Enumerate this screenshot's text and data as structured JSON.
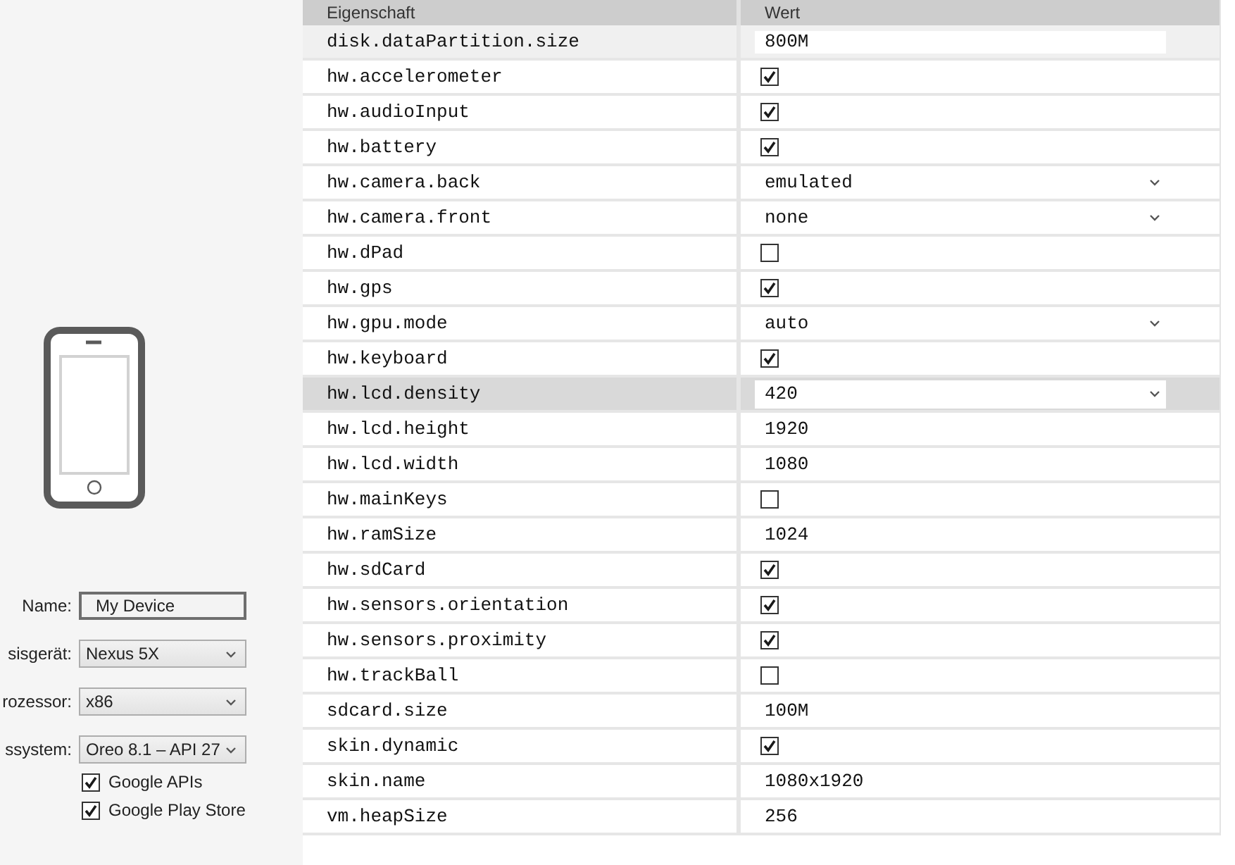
{
  "device_panel": {
    "fields": [
      {
        "kind": "text",
        "label": "Name:",
        "value": "My Device"
      },
      {
        "kind": "dropdown",
        "label": "sisgerät:",
        "value": "Nexus 5X"
      },
      {
        "kind": "dropdown",
        "label": "rozessor:",
        "value": "x86"
      },
      {
        "kind": "dropdown",
        "label": "ssystem:",
        "value": "Oreo 8.1 – API 27"
      }
    ],
    "options": [
      {
        "label": "Google APIs",
        "checked": true
      },
      {
        "label": "Google Play Store",
        "checked": true
      }
    ]
  },
  "table": {
    "columns": [
      {
        "label": "Eigenschaft"
      },
      {
        "label": "Wert"
      }
    ],
    "rows": [
      {
        "name": "disk.dataPartition.size",
        "kind": "text",
        "value": "800M",
        "selected": false,
        "hovered": true
      },
      {
        "name": "hw.accelerometer",
        "kind": "checkbox",
        "checked": true,
        "selected": false,
        "hovered": false
      },
      {
        "name": "hw.audioInput",
        "kind": "checkbox",
        "checked": true,
        "selected": false,
        "hovered": false
      },
      {
        "name": "hw.battery",
        "kind": "checkbox",
        "checked": true,
        "selected": false,
        "hovered": false
      },
      {
        "name": "hw.camera.back",
        "kind": "dropdown",
        "value": "emulated",
        "selected": false,
        "hovered": false
      },
      {
        "name": "hw.camera.front",
        "kind": "dropdown",
        "value": "none",
        "selected": false,
        "hovered": false
      },
      {
        "name": "hw.dPad",
        "kind": "checkbox",
        "checked": false,
        "selected": false,
        "hovered": false
      },
      {
        "name": "hw.gps",
        "kind": "checkbox",
        "checked": true,
        "selected": false,
        "hovered": false
      },
      {
        "name": "hw.gpu.mode",
        "kind": "dropdown",
        "value": "auto",
        "selected": false,
        "hovered": false
      },
      {
        "name": "hw.keyboard",
        "kind": "checkbox",
        "checked": true,
        "selected": false,
        "hovered": false
      },
      {
        "name": "hw.lcd.density",
        "kind": "dropdown",
        "value": "420",
        "selected": true,
        "hovered": false
      },
      {
        "name": "hw.lcd.height",
        "kind": "text",
        "value": "1920",
        "selected": false,
        "hovered": false
      },
      {
        "name": "hw.lcd.width",
        "kind": "text",
        "value": "1080",
        "selected": false,
        "hovered": false
      },
      {
        "name": "hw.mainKeys",
        "kind": "checkbox",
        "checked": false,
        "selected": false,
        "hovered": false
      },
      {
        "name": "hw.ramSize",
        "kind": "text",
        "value": "1024",
        "selected": false,
        "hovered": false
      },
      {
        "name": "hw.sdCard",
        "kind": "checkbox",
        "checked": true,
        "selected": false,
        "hovered": false
      },
      {
        "name": "hw.sensors.orientation",
        "kind": "checkbox",
        "checked": true,
        "selected": false,
        "hovered": false
      },
      {
        "name": "hw.sensors.proximity",
        "kind": "checkbox",
        "checked": true,
        "selected": false,
        "hovered": false
      },
      {
        "name": "hw.trackBall",
        "kind": "checkbox",
        "checked": false,
        "selected": false,
        "hovered": false
      },
      {
        "name": "sdcard.size",
        "kind": "text",
        "value": "100M",
        "selected": false,
        "hovered": false
      },
      {
        "name": "skin.dynamic",
        "kind": "checkbox",
        "checked": true,
        "selected": false,
        "hovered": false
      },
      {
        "name": "skin.name",
        "kind": "text",
        "value": "1080x1920",
        "selected": false,
        "hovered": false
      },
      {
        "name": "vm.heapSize",
        "kind": "text",
        "value": "256",
        "selected": false,
        "hovered": false
      }
    ]
  }
}
